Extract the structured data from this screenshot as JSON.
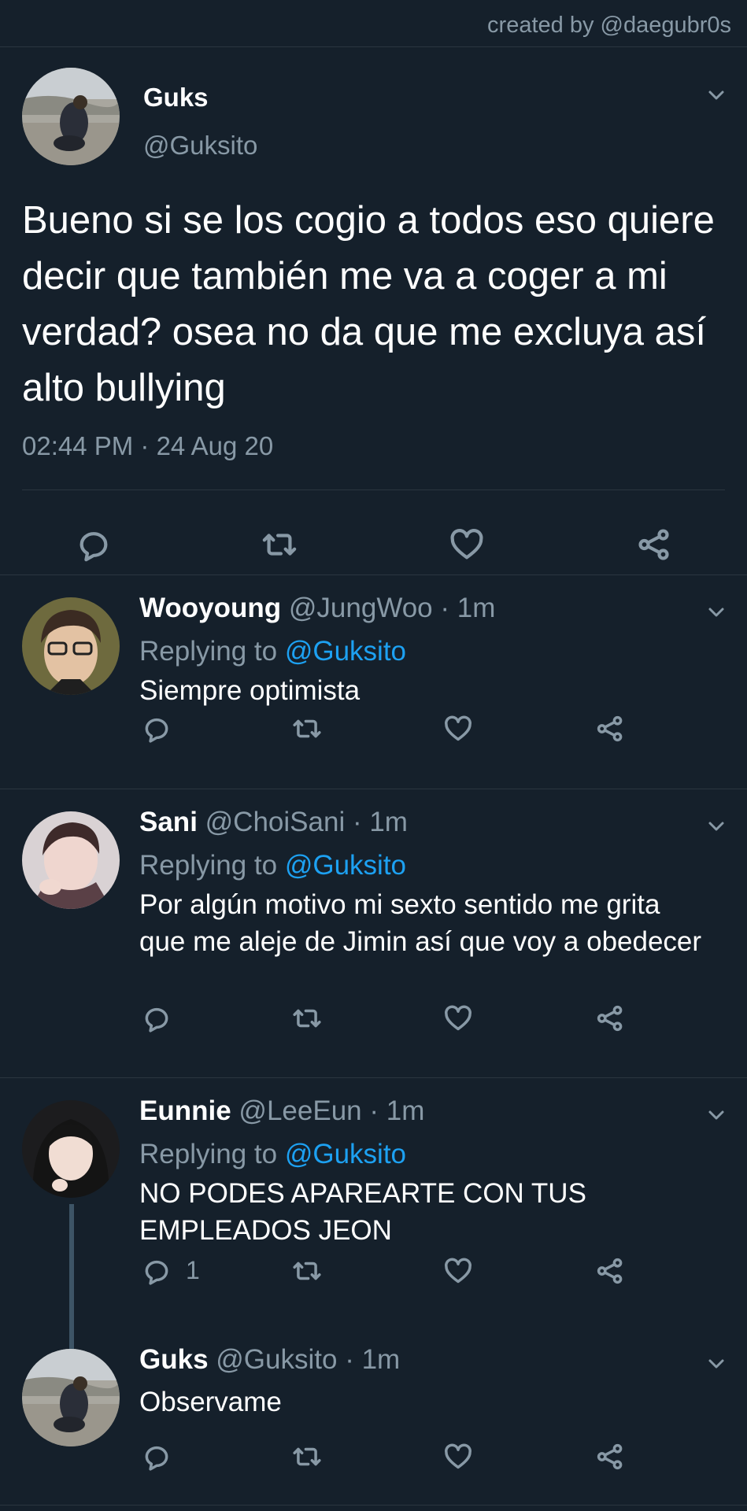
{
  "credit": "created by @daegubr0s",
  "main_tweet": {
    "name": "Guks",
    "handle": "@Guksito",
    "text": "Bueno si se los cogio a todos eso quiere decir que también me va a coger a mi verdad? osea no da que me excluya así alto bullying",
    "timestamp": "02:44 PM · 24 Aug 20"
  },
  "replies": [
    {
      "name": "Wooyoung",
      "handle": "@JungWoo",
      "sep": " · ",
      "time": "1m",
      "replying_prefix": "Replying to ",
      "replying_to": "@Guksito",
      "text": "Siempre optimista",
      "reply_count": ""
    },
    {
      "name": "Sani",
      "handle": "@ChoiSani",
      "sep": " · ",
      "time": "1m",
      "replying_prefix": "Replying to ",
      "replying_to": "@Guksito",
      "text": "Por algún motivo mi sexto sentido me grita que me aleje de Jimin así que voy a obedecer",
      "reply_count": ""
    },
    {
      "name": "Eunnie",
      "handle": "@LeeEun",
      "sep": " · ",
      "time": "1m",
      "replying_prefix": "Replying to ",
      "replying_to": "@Guksito",
      "text": "NO PODES APAREARTE CON TUS EMPLEADOS JEON",
      "reply_count": "1"
    },
    {
      "name": "Guks",
      "handle": "@Guksito",
      "sep": " · ",
      "time": "1m",
      "text": "Observame",
      "reply_count": ""
    }
  ],
  "icons": {
    "reply": "reply-icon",
    "retweet": "retweet-icon",
    "like": "heart-icon",
    "share": "share-icon",
    "more": "chevron-down-icon"
  },
  "colors": {
    "background": "#15202b",
    "text": "#ffffff",
    "secondary": "#8899a6",
    "link": "#1da1f2",
    "divider": "#2b3640",
    "thread_line": "#3d5466"
  }
}
